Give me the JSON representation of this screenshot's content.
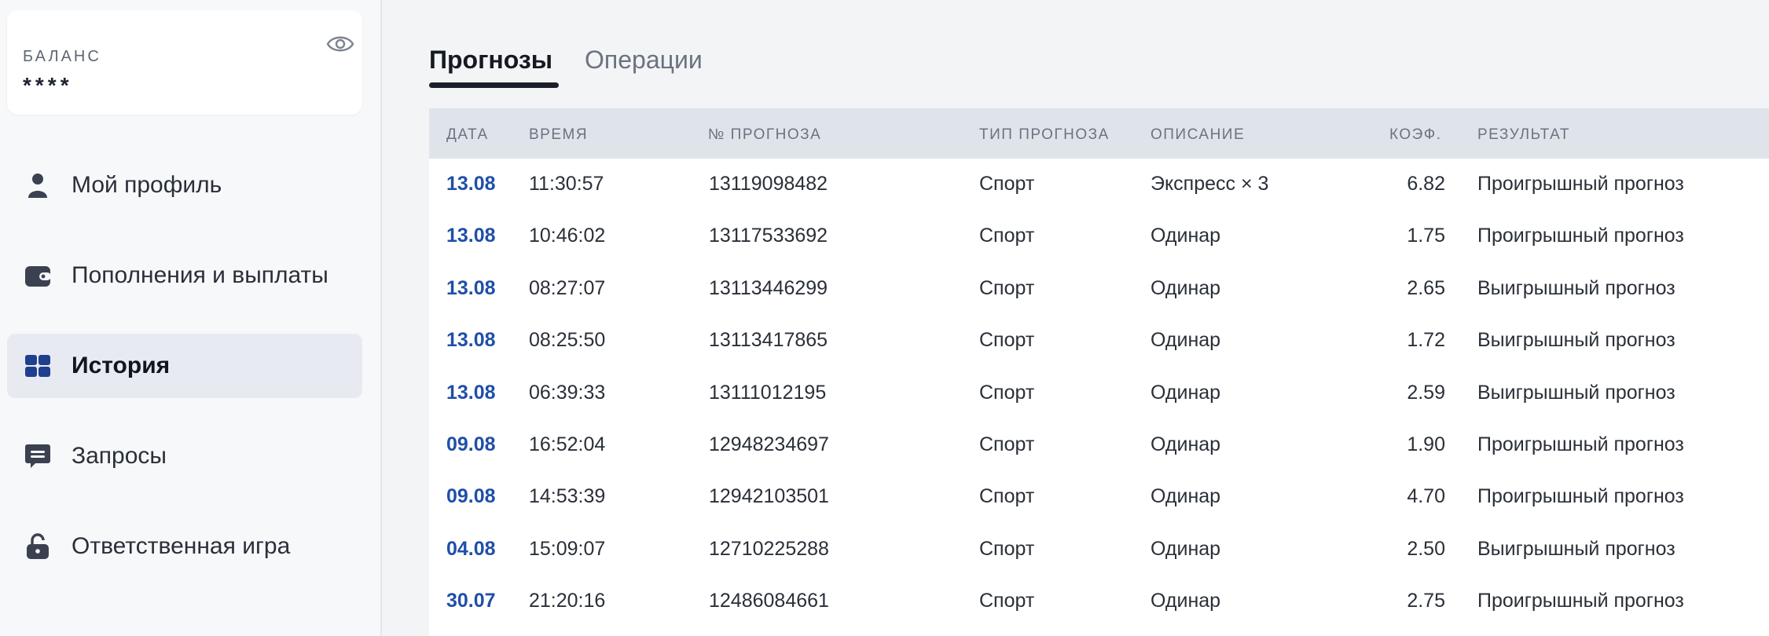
{
  "balance": {
    "label": "БАЛАНС",
    "value": "****",
    "icon": "eye-icon"
  },
  "sidebar": {
    "items": [
      {
        "label": "Мой профиль",
        "icon": "user-icon",
        "active": false
      },
      {
        "label": "Пополнения и выплаты",
        "icon": "wallet-icon",
        "active": false
      },
      {
        "label": "История",
        "icon": "history-icon",
        "active": true
      },
      {
        "label": "Запросы",
        "icon": "message-icon",
        "active": false
      },
      {
        "label": "Ответственная игра",
        "icon": "lock-icon",
        "active": false
      }
    ]
  },
  "tabs": [
    {
      "label": "Прогнозы",
      "active": true
    },
    {
      "label": "Операции",
      "active": false
    }
  ],
  "table": {
    "columns": [
      "ДАТА",
      "ВРЕМЯ",
      "№ ПРОГНОЗА",
      "ТИП ПРОГНОЗА",
      "ОПИСАНИЕ",
      "КОЭФ.",
      "РЕЗУЛЬТАТ"
    ],
    "rows": [
      [
        "13.08",
        "11:30:57",
        "13119098482",
        "Спорт",
        "Экспресс × 3",
        "6.82",
        "Проигрышный прогноз"
      ],
      [
        "13.08",
        "10:46:02",
        "13117533692",
        "Спорт",
        "Одинар",
        "1.75",
        "Проигрышный прогноз"
      ],
      [
        "13.08",
        "08:27:07",
        "13113446299",
        "Спорт",
        "Одинар",
        "2.65",
        "Выигрышный прогноз"
      ],
      [
        "13.08",
        "08:25:50",
        "13113417865",
        "Спорт",
        "Одинар",
        "1.72",
        "Выигрышный прогноз"
      ],
      [
        "13.08",
        "06:39:33",
        "13111012195",
        "Спорт",
        "Одинар",
        "2.59",
        "Выигрышный прогноз"
      ],
      [
        "09.08",
        "16:52:04",
        "12948234697",
        "Спорт",
        "Одинар",
        "1.90",
        "Проигрышный прогноз"
      ],
      [
        "09.08",
        "14:53:39",
        "12942103501",
        "Спорт",
        "Одинар",
        "4.70",
        "Проигрышный прогноз"
      ],
      [
        "04.08",
        "15:09:07",
        "12710225288",
        "Спорт",
        "Одинар",
        "2.50",
        "Выигрышный прогноз"
      ],
      [
        "30.07",
        "21:20:16",
        "12486084661",
        "Спорт",
        "Одинар",
        "2.75",
        "Проигрышный прогноз"
      ]
    ]
  },
  "colors": {
    "accent": "#1f4fa8",
    "active_nav_bg": "#e7ebf1",
    "header_bg": "#dfe4eb",
    "icon": "#3b4150",
    "history_icon": "#1f3f8f"
  }
}
